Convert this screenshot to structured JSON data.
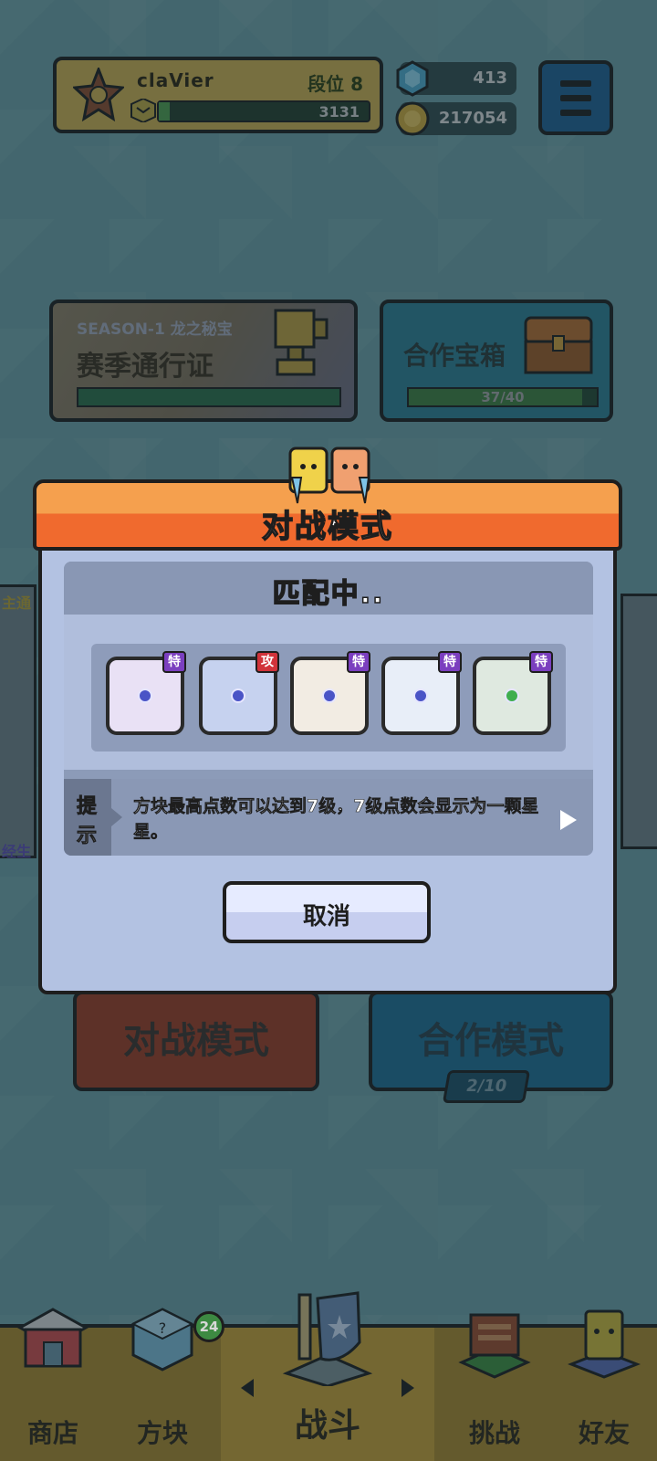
{
  "profile": {
    "name": "claVier",
    "rank_label": "段位 8",
    "exp": "3131"
  },
  "currency": {
    "gems": "413",
    "gold": "217054"
  },
  "season": {
    "subtitle": "SEASON-1 龙之秘宝",
    "title": "赛季通行证"
  },
  "coop_chest": {
    "title": "合作宝箱",
    "progress": "37/40"
  },
  "modes": {
    "battle": "对战模式",
    "coop": "合作模式",
    "coop_counter": "2/10"
  },
  "side": {
    "left_top": "主通",
    "left_bottom": "经生"
  },
  "modal": {
    "title": "对战模式",
    "status": "匹配中..",
    "dice": [
      {
        "tag": "特",
        "tag_color": "#7b3fbf",
        "face": "#e9e1f5",
        "icon": "purple-dragon-die-icon"
      },
      {
        "tag": "攻",
        "tag_color": "#d1333a",
        "face": "#c6d2ef",
        "icon": "gear-die-icon"
      },
      {
        "tag": "特",
        "tag_color": "#7b3fbf",
        "face": "#f2ece3",
        "icon": "infinity-die-icon"
      },
      {
        "tag": "特",
        "tag_color": "#7b3fbf",
        "face": "#e8eef8",
        "icon": "hands-die-icon"
      },
      {
        "tag": "特",
        "tag_color": "#7b3fbf",
        "face": "#dfe9e0",
        "icon": "pentagram-die-icon"
      }
    ],
    "tip_label_1": "提",
    "tip_label_2": "示",
    "tip_text": "方块最高点数可以达到7级，7级点数会显示为一颗星星。",
    "cancel": "取消"
  },
  "nav": {
    "shop": "商店",
    "dice": "方块",
    "dice_badge": "24",
    "battle": "战斗",
    "challenge": "挑战",
    "friends": "好友"
  }
}
